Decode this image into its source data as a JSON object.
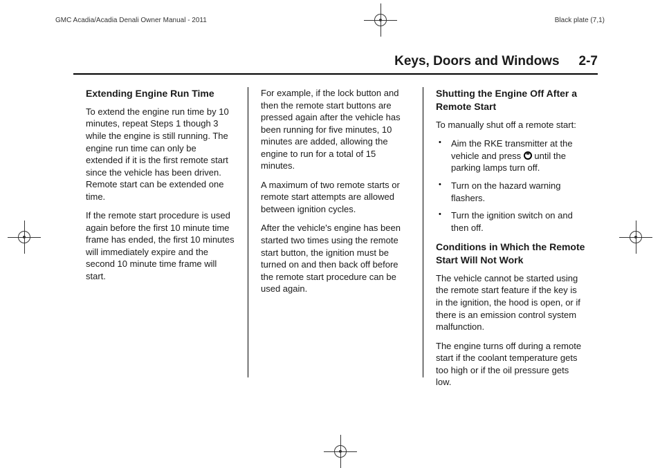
{
  "meta": {
    "manual_title": "GMC Acadia/Acadia Denali Owner Manual - 2011",
    "plate": "Black plate (7,1)"
  },
  "header": {
    "section_title": "Keys, Doors and Windows",
    "page_ref": "2-7"
  },
  "col1": {
    "h1": "Extending Engine Run Time",
    "p1": "To extend the engine run time by 10 minutes, repeat Steps 1 though 3 while the engine is still running. The engine run time can only be extended if it is the first remote start since the vehicle has been driven. Remote start can be extended one time.",
    "p2": "If the remote start procedure is used again before the first 10 minute time frame has ended, the first 10 minutes will immediately expire and the second 10 minute time frame will start."
  },
  "col2": {
    "p1": "For example, if the lock button and then the remote start buttons are pressed again after the vehicle has been running for five minutes, 10 minutes are added, allowing the engine to run for a total of 15 minutes.",
    "p2": "A maximum of two remote starts or remote start attempts are allowed between ignition cycles.",
    "p3": "After the vehicle's engine has been started two times using the remote start button, the ignition must be turned on and then back off before the remote start procedure can be used again."
  },
  "col3": {
    "h1": "Shutting the Engine Off After a Remote Start",
    "intro": "To manually shut off a remote start:",
    "bullets": {
      "b1a": "Aim the RKE transmitter at the vehicle and press ",
      "b1b": " until the parking lamps turn off.",
      "b2": "Turn on the hazard warning flashers.",
      "b3": "Turn the ignition switch on and then off."
    },
    "h2": "Conditions in Which the Remote Start Will Not Work",
    "p1": "The vehicle cannot be started using the remote start feature if the key is in the ignition, the hood is open, or if there is an emission control system malfunction.",
    "p2": "The engine turns off during a remote start if the coolant temperature gets too high or if the oil pressure gets low."
  }
}
